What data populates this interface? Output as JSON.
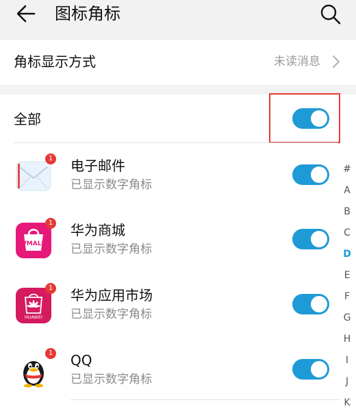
{
  "header": {
    "title": "图标角标"
  },
  "badge_mode": {
    "label": "角标显示方式",
    "value": "未读消息"
  },
  "all_toggle": {
    "label": "全部",
    "on": true
  },
  "apps": [
    {
      "name": "电子邮件",
      "status": "已显示数字角标",
      "badge": "1",
      "icon": "email-icon",
      "on": true
    },
    {
      "name": "华为商城",
      "status": "已显示数字角标",
      "badge": "1",
      "icon": "vmall-icon",
      "on": true,
      "icon_text": "VMALL"
    },
    {
      "name": "华为应用市场",
      "status": "已显示数字角标",
      "badge": "1",
      "icon": "huawei-appgallery-icon",
      "on": true,
      "icon_text": "HUAWEI"
    },
    {
      "name": "QQ",
      "status": "已显示数字角标",
      "badge": "1",
      "icon": "qq-penguin-icon",
      "on": true
    }
  ],
  "index_bar": {
    "letters": [
      "#",
      "A",
      "B",
      "C",
      "D",
      "E",
      "F",
      "G",
      "H",
      "I",
      "J",
      "K"
    ],
    "active": "D"
  },
  "colors": {
    "accent": "#1e9ad6",
    "badge": "#e53935",
    "highlight": "#e53935",
    "vmall": "#e6197a",
    "appgallery": "#d51a5f"
  }
}
